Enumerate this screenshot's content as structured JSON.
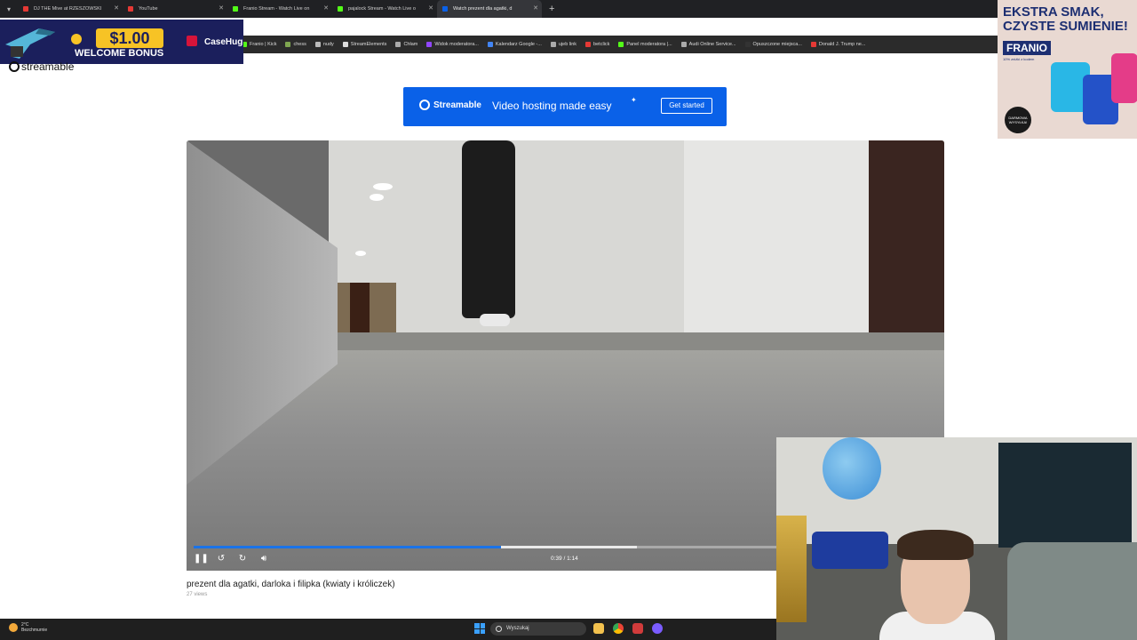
{
  "browser": {
    "tabs": [
      {
        "title": "DJ THE Mive at RZESZOWSKI",
        "color": "#e53935",
        "active": false
      },
      {
        "title": "YouTube",
        "color": "#e53935",
        "active": false
      },
      {
        "title": "Franio Stream - Watch Live on",
        "color": "#53fc18",
        "active": false
      },
      {
        "title": "pajalock Stream - Watch Live o",
        "color": "#53fc18",
        "active": false
      },
      {
        "title": "Watch prezent dla agatki, d",
        "color": "#0a61e8",
        "active": true
      }
    ],
    "bookmarks": [
      {
        "label": "Franio | Kick",
        "color": "#53fc18"
      },
      {
        "label": "chess",
        "color": "#7fa650"
      },
      {
        "label": "nudy",
        "color": "#bbbbbb"
      },
      {
        "label": "StreamElements",
        "color": "#dddddd"
      },
      {
        "label": "Chłam",
        "color": "#aaaaaa"
      },
      {
        "label": "Widok moderatora...",
        "color": "#9146ff"
      },
      {
        "label": "Kalendarz Google -...",
        "color": "#4285f4"
      },
      {
        "label": "ujeb link",
        "color": "#aaaaaa"
      },
      {
        "label": "betclick",
        "color": "#e53935"
      },
      {
        "label": "Panel moderatora |...",
        "color": "#53fc18"
      },
      {
        "label": "Audi Online Service...",
        "color": "#aaaaaa"
      },
      {
        "label": "Opuszczone miejsca...",
        "color": "#333333"
      },
      {
        "label": "Donald J. Trump ne...",
        "color": "#e53935"
      }
    ]
  },
  "casino_ad": {
    "amount": "$1.00",
    "bonus_text": "WELCOME BONUS",
    "brand": "CaseHug"
  },
  "page": {
    "logo_text": "streamable",
    "banner": {
      "brand": "Streamable",
      "tagline": "Video hosting made easy",
      "cta": "Get started"
    },
    "video": {
      "progress_fraction": 0.527,
      "buffer_fraction": 0.76,
      "timecode": "0:39 / 1:14"
    },
    "title": "prezent dla agatki, darloka i filipka (kwiaty i króliczek)",
    "views": "27 views"
  },
  "snack_ad": {
    "headline": "EKSTRA SMAK, CZYSTE SUMIENIE!",
    "brand": "FRANIO",
    "subline": "10% zniżki z kodem",
    "badge": "DARMOWA WYSYŁKA!"
  },
  "taskbar": {
    "temperature": "2°C",
    "weather": "Bezchmurnie",
    "search_placeholder": "Wyszukaj"
  }
}
